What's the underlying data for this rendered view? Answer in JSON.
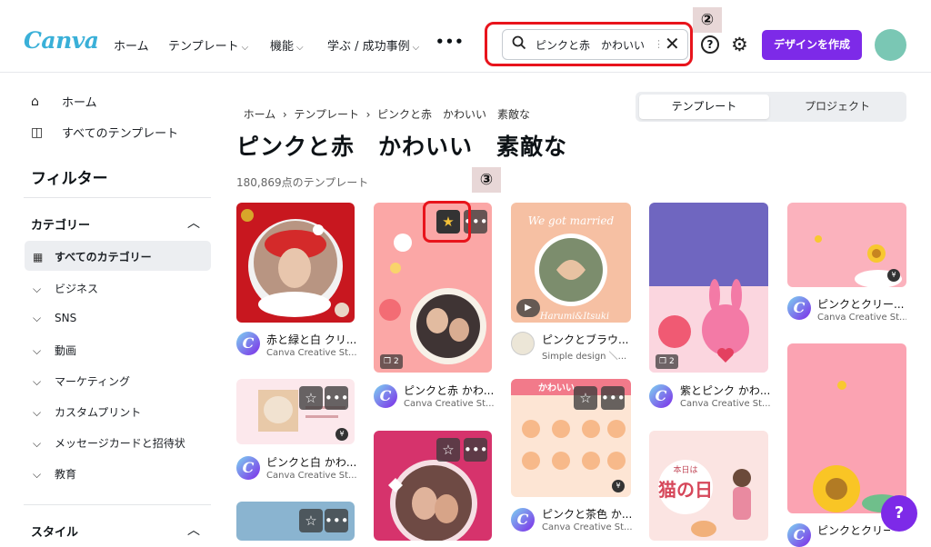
{
  "header": {
    "logo": "Canva",
    "nav": [
      {
        "label": "ホーム",
        "chevron": false
      },
      {
        "label": "テンプレート",
        "chevron": true
      },
      {
        "label": "機能",
        "chevron": true
      },
      {
        "label": "学ぶ / 成功事例",
        "chevron": true
      }
    ],
    "more": "•••",
    "search_value": "ピンクと赤　かわいい",
    "create_button": "デザインを作成",
    "annotation_2": "②",
    "annotation_3": "③",
    "help": "?"
  },
  "sidebar": {
    "home": "ホーム",
    "all_templates": "すべてのテンプレート",
    "filter_title": "フィルター",
    "category_head": "カテゴリー",
    "categories": [
      "すべてのカテゴリー",
      "ビジネス",
      "SNS",
      "動画",
      "マーケティング",
      "カスタムプリント",
      "メッセージカードと招待状",
      "教育"
    ],
    "style_head": "スタイル"
  },
  "main": {
    "breadcrumb": [
      "ホーム",
      "テンプレート",
      "ピンクと赤　かわいい　素敵な"
    ],
    "tabs": [
      "テンプレート",
      "プロジェクト"
    ],
    "title": "ピンクと赤　かわいい　素敵な",
    "count": "180,869点のテンプレート"
  },
  "cards": [
    {
      "title": "赤と緑と白 クリ...",
      "sub": "Canva Creative St..."
    },
    {
      "title": "ピンクと白 かわ...",
      "sub": "Canva Creative St...",
      "price": "¥"
    },
    {
      "title": "ピンクと赤 かわ...",
      "sub": "Canva Creative St...",
      "pages": "2"
    },
    {
      "title": "ピンクとブラウ...",
      "sub": "Simple design ＼...",
      "thumb_text": "We got married",
      "thumb_sub": "Harumi&Itsuki"
    },
    {
      "title": "ピンクと茶色 か...",
      "sub": "Canva Creative St...",
      "price": "¥",
      "thumb_text": "かわいい"
    },
    {
      "title": "紫とピンク かわ...",
      "sub": "Canva Creative St...",
      "pages": "2"
    },
    {
      "title": "ピンクとクリー...",
      "sub": "Canva Creative St...",
      "price": "¥"
    },
    {
      "title": "ピンクとクリー...",
      "sub": "",
      "price": "¥"
    }
  ],
  "misc": {
    "neko_title": "猫の日",
    "neko_small": "本日は",
    "fab": "?"
  }
}
